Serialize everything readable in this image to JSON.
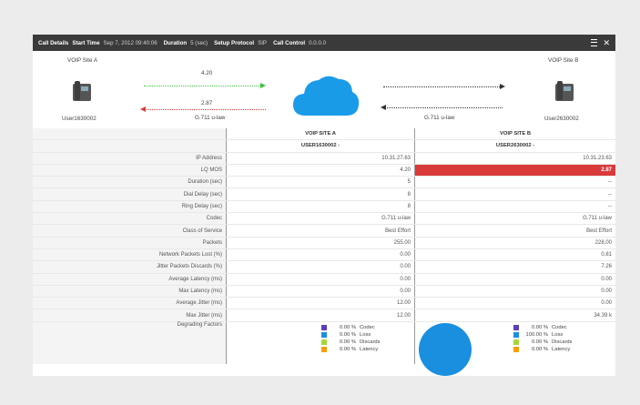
{
  "titlebar": {
    "call_details": "Call Details",
    "start_time_label": "Start Time",
    "start_time": "Sep 7, 2012 09:40:06",
    "duration_label": "Duration",
    "duration": "5 (sec)",
    "setup_label": "Setup Protocol",
    "setup": "SIP",
    "control_label": "Call Control",
    "control": "0.0.0.0"
  },
  "diagram": {
    "site_a": "VOIP Site A",
    "site_b": "VOIP Site B",
    "user_a": "User1630002",
    "user_b": "User2630002",
    "mos_a": "4.20",
    "mos_b": "2.87",
    "codec_a": "G.711 u-law",
    "codec_b": "G.711 u-law",
    "color_good": "#3cc23c",
    "color_bad": "#d93b3b",
    "cloud_color": "#1a9be8"
  },
  "table": {
    "header_a": "VOIP SITE A",
    "header_b": "VOIP SITE B",
    "user_a": "USER1630002 -",
    "user_b": "USER2630002 -",
    "rows": [
      {
        "label": "IP Address",
        "a": "10.31.27.63",
        "b": "10.31.23.63"
      },
      {
        "label": "LQ MOS",
        "a": "4.20",
        "b": "2.87"
      },
      {
        "label": "Duration (sec)",
        "a": "5",
        "b": "--"
      },
      {
        "label": "Dial Delay (sec)",
        "a": "8",
        "b": "--"
      },
      {
        "label": "Ring Delay (sec)",
        "a": "8",
        "b": "--"
      },
      {
        "label": "Codec",
        "a": "G.711 u-law",
        "b": "G.711 u-law"
      },
      {
        "label": "Class of Service",
        "a": "Best Effort",
        "b": "Best Effort"
      },
      {
        "label": "Packets",
        "a": "255.00",
        "b": "228.00"
      },
      {
        "label": "Network Packets Lost (%)",
        "a": "0.00",
        "b": "0.81"
      },
      {
        "label": "Jitter Packets Discards (%)",
        "a": "0.00",
        "b": "7.26"
      },
      {
        "label": "Average Latency (ms)",
        "a": "0.00",
        "b": "0.00"
      },
      {
        "label": "Max Latency (ms)",
        "a": "0.00",
        "b": "0.00"
      },
      {
        "label": "Average Jitter (ms)",
        "a": "12.00",
        "b": "0.00"
      },
      {
        "label": "Max Jitter (ms)",
        "a": "12.00",
        "b": "34.39 k"
      }
    ],
    "degrading_label": "Degrading Factors",
    "factors_a": [
      {
        "pct": "0.00 %",
        "name": "Codec",
        "color": "#5b3fb8"
      },
      {
        "pct": "0.00 %",
        "name": "Loss",
        "color": "#1a8fe0"
      },
      {
        "pct": "0.00 %",
        "name": "Discards",
        "color": "#a6d63a"
      },
      {
        "pct": "0.00 %",
        "name": "Latency",
        "color": "#f5a000"
      }
    ],
    "factors_b": [
      {
        "pct": "0.00 %",
        "name": "Codec",
        "color": "#5b3fb8"
      },
      {
        "pct": "100.00 %",
        "name": "Loss",
        "color": "#1a8fe0"
      },
      {
        "pct": "0.00 %",
        "name": "Discards",
        "color": "#a6d63a"
      },
      {
        "pct": "0.00 %",
        "name": "Latency",
        "color": "#f5a000"
      }
    ]
  }
}
